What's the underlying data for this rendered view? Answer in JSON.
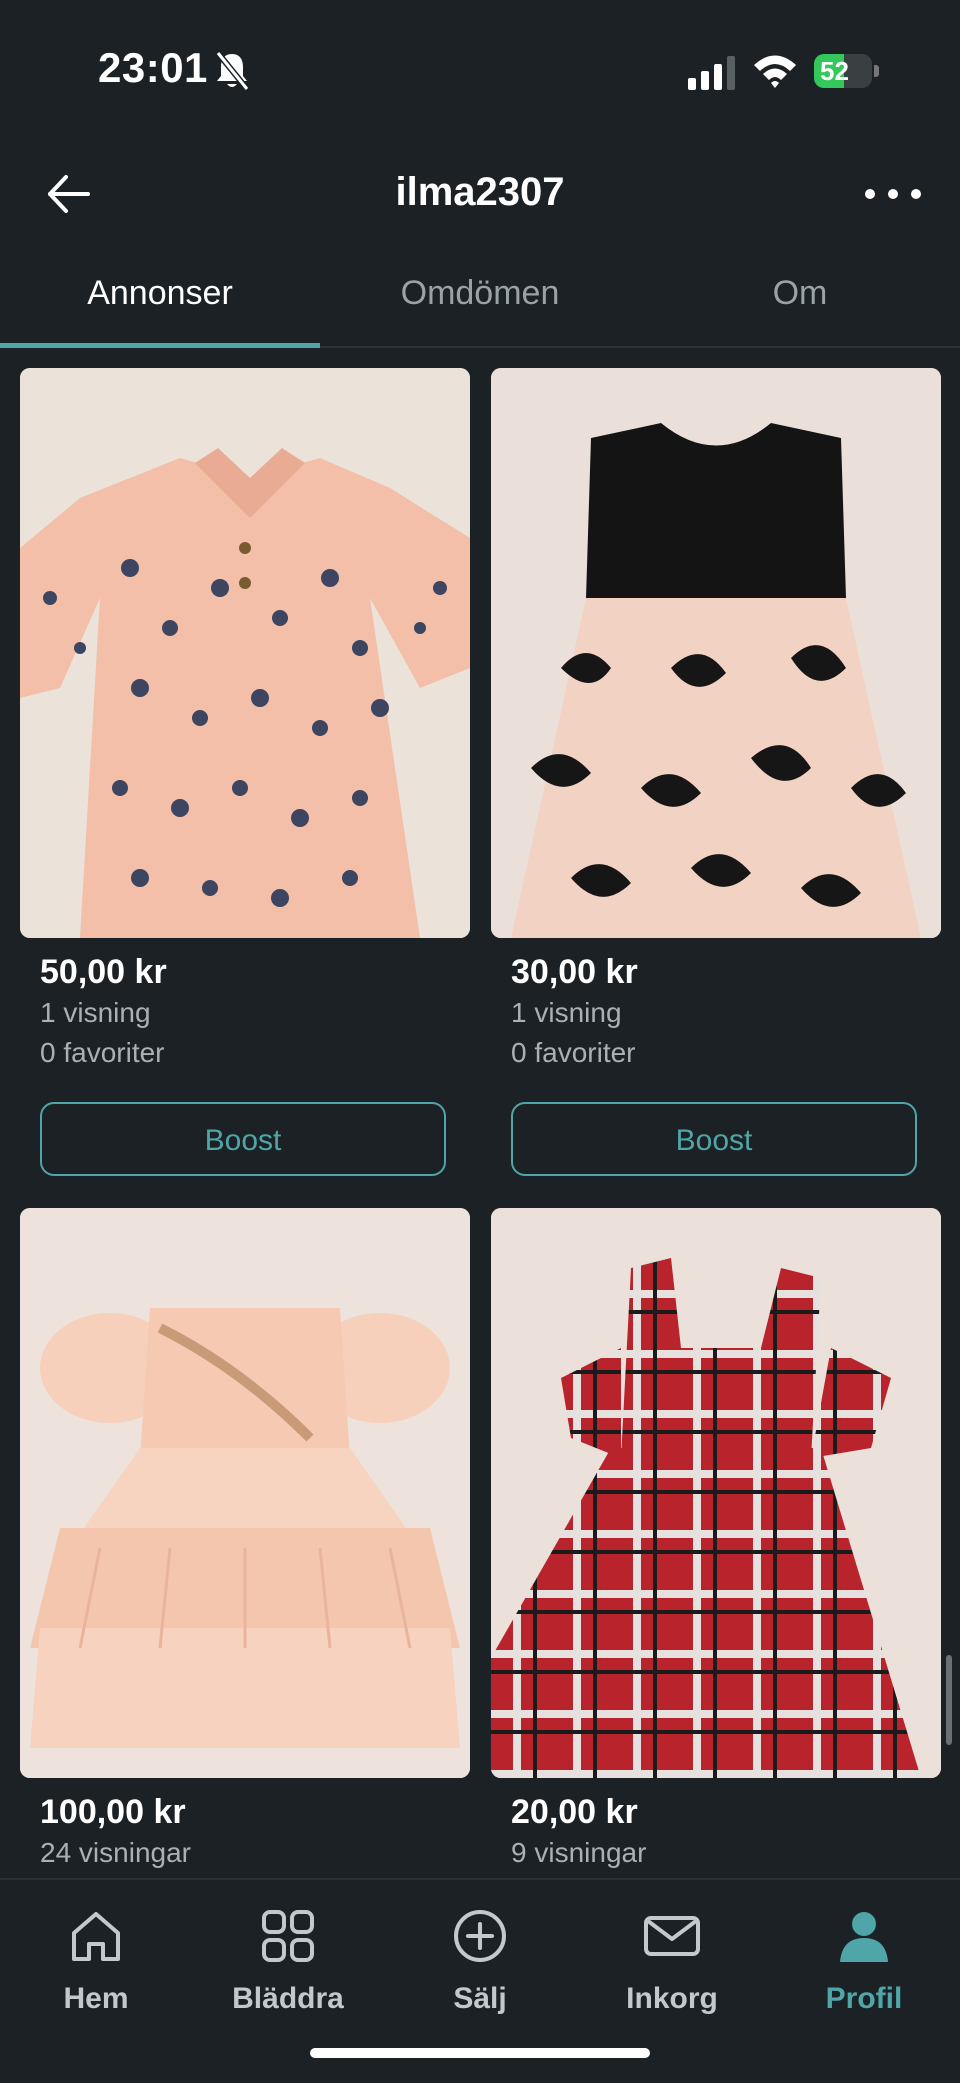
{
  "status_bar": {
    "time": "23:01",
    "battery": "52",
    "battery_level": 0.52,
    "icons": [
      "bell-slash-icon",
      "cellular-signal-icon",
      "wifi-icon",
      "battery-charging-icon"
    ]
  },
  "header": {
    "title": "ilma2307",
    "back_icon": "arrow-left-icon",
    "more_icon": "more-horizontal-icon"
  },
  "tabs": [
    {
      "label": "Annonser",
      "active": true
    },
    {
      "label": "Omdömen",
      "active": false
    },
    {
      "label": "Om",
      "active": false
    }
  ],
  "listings": [
    {
      "price": "50,00 kr",
      "views": "1 visning",
      "favorites": "0 favoriter",
      "button": "Boost",
      "image": "peach floral long-sleeve dress"
    },
    {
      "price": "30,00 kr",
      "views": "1 visning",
      "favorites": "0 favoriter",
      "button": "Boost",
      "image": "black top tulle floral dress"
    },
    {
      "price": "100,00 kr",
      "views": "24 visningar",
      "favorites": "",
      "button": "",
      "image": "peach tulle party dress"
    },
    {
      "price": "20,00 kr",
      "views": "9 visningar",
      "favorites": "",
      "button": "",
      "image": "red plaid pinafore dress"
    }
  ],
  "bottom_nav": [
    {
      "label": "Hem",
      "icon": "home-icon",
      "active": false
    },
    {
      "label": "Bläddra",
      "icon": "grid-icon",
      "active": false
    },
    {
      "label": "Sälj",
      "icon": "plus-circle-icon",
      "active": false
    },
    {
      "label": "Inkorg",
      "icon": "mail-icon",
      "active": false
    },
    {
      "label": "Profil",
      "icon": "profile-icon",
      "active": true
    }
  ],
  "colors": {
    "background": "#1c2125",
    "accent": "#4fa5a8",
    "battery": "#34c759"
  }
}
